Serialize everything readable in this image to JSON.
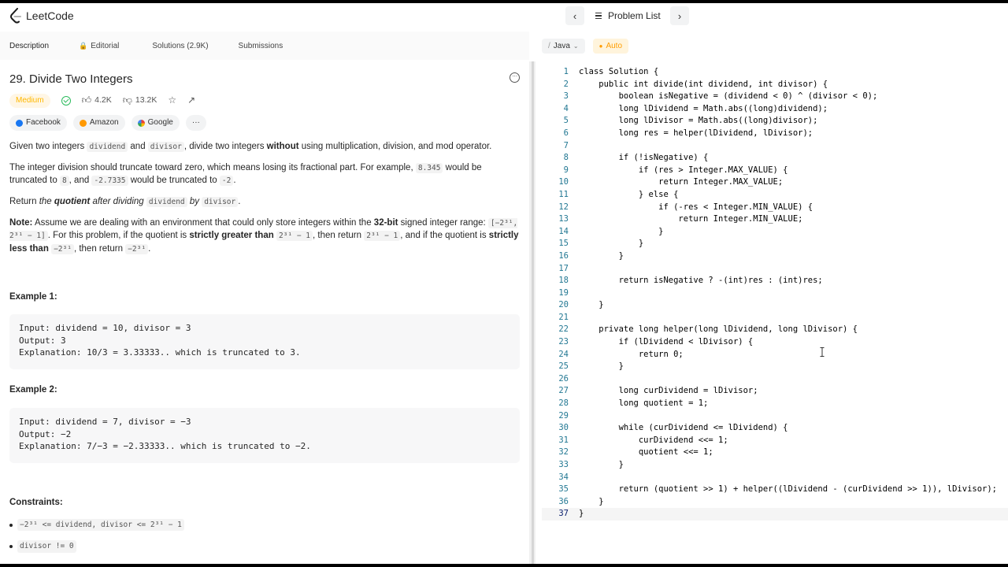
{
  "app": {
    "name": "LeetCode"
  },
  "nav": {
    "problem_list": "Problem List",
    "prev": "‹",
    "next": "›"
  },
  "tabs": [
    {
      "label": "Description"
    },
    {
      "label": "Editorial"
    },
    {
      "label": "Solutions (2.9K)"
    },
    {
      "label": "Submissions"
    }
  ],
  "problem": {
    "title": "29. Divide Two Integers",
    "difficulty": "Medium",
    "likes": "4.2K",
    "dislikes": "13.2K",
    "companies": [
      "Facebook",
      "Amazon",
      "Google"
    ],
    "more_companies": "···",
    "p1": {
      "a": "Given two integers ",
      "c1": "dividend",
      "b": " and ",
      "c2": "divisor",
      "c": ", divide two integers ",
      "strong": "without",
      "d": " using multiplication, division, and mod operator."
    },
    "p2": {
      "a": "The integer division should truncate toward zero, which means losing its fractional part. For example, ",
      "c1": "8.345",
      "b": " would be truncated to ",
      "c2": "8",
      "c": ", and ",
      "c3": "-2.7335",
      "d": " would be truncated to ",
      "c4": "-2",
      "e": "."
    },
    "p3": {
      "a": "Return ",
      "em1": "the ",
      "strong": "quotient",
      "em2": " after dividing ",
      "c1": "dividend",
      "em3": " by ",
      "c2": "divisor",
      "e": "."
    },
    "note": {
      "label": "Note:",
      "a": " Assume we are dealing with an environment that could only store integers within the ",
      "bits": "32-bit",
      "b": " signed integer range: ",
      "range": "[−2³¹, 2³¹ − 1]",
      "c": ". For this problem, if the quotient is ",
      "s1": "strictly greater than",
      "c1": "2³¹ − 1",
      "d": ", then return ",
      "c2": "2³¹ − 1",
      "e": ", and if the quotient is ",
      "s2": "strictly less than",
      "c3": "−2³¹",
      "f": ", then return ",
      "c4": "−2³¹",
      "g": "."
    },
    "example1_title": "Example 1:",
    "example1": "Input: dividend = 10, divisor = 3\nOutput: 3\nExplanation: 10/3 = 3.33333.. which is truncated to 3.",
    "example2_title": "Example 2:",
    "example2": "Input: dividend = 7, divisor = −3\nOutput: −2\nExplanation: 7/−3 = −2.33333.. which is truncated to −2.",
    "constraints_title": "Constraints:",
    "constraints": [
      "−2³¹ <= dividend, divisor <= 2³¹ − 1",
      "divisor != 0"
    ]
  },
  "editor": {
    "language": "Java",
    "mode": "Auto",
    "lines": [
      "class Solution {",
      "    public int divide(int dividend, int divisor) {",
      "        boolean isNegative = (dividend < 0) ^ (divisor < 0);",
      "        long lDividend = Math.abs((long)dividend);",
      "        long lDivisor = Math.abs((long)divisor);",
      "        long res = helper(lDividend, lDivisor);",
      "",
      "        if (!isNegative) {",
      "            if (res > Integer.MAX_VALUE) {",
      "                return Integer.MAX_VALUE;",
      "            } else {",
      "                if (-res < Integer.MIN_VALUE) {",
      "                    return Integer.MIN_VALUE;",
      "                }",
      "            }",
      "        }",
      "",
      "        return isNegative ? -(int)res : (int)res;",
      "",
      "    }",
      "",
      "    private long helper(long lDividend, long lDivisor) {",
      "        if (lDividend < lDivisor) {",
      "            return 0;",
      "        }",
      "",
      "        long curDividend = lDivisor;",
      "        long quotient = 1;",
      "",
      "        while (curDividend <= lDividend) {",
      "            curDividend <<= 1;",
      "            quotient <<= 1;",
      "        }",
      "",
      "        return (quotient >> 1) + helper((lDividend - (curDividend >> 1)), lDivisor);",
      "    }",
      "}"
    ]
  }
}
